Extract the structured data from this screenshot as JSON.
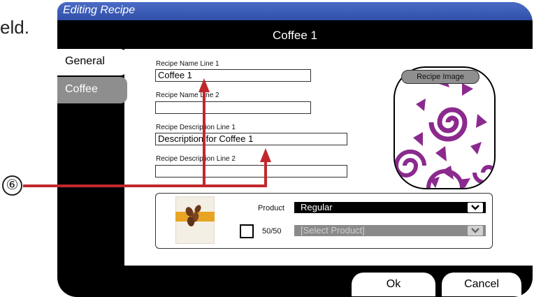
{
  "frag_text": "eld.",
  "window": {
    "title": "Editing Recipe",
    "recipe_name": "Coffee 1"
  },
  "tabs": [
    {
      "label": "General",
      "active": true
    },
    {
      "label": "Coffee",
      "active": false
    }
  ],
  "form": {
    "name_line1_label": "Recipe Name Line 1",
    "name_line1_value": "Coffee 1",
    "name_line2_label": "Recipe Name Line 2",
    "name_line2_value": "",
    "desc_line1_label": "Recipe Description Line 1",
    "desc_line1_value": "Description for Coffee 1",
    "desc_line2_label": "Recipe Description Line 2",
    "desc_line2_value": ""
  },
  "image_panel": {
    "button_label": "Recipe Image"
  },
  "product": {
    "product_label": "Product",
    "product_value": "Regular",
    "fifty_label": "50/50",
    "fifty_checked": false,
    "fifty_placeholder": "[Select Product]"
  },
  "buttons": {
    "ok": "Ok",
    "cancel": "Cancel"
  },
  "callout": {
    "number": "⑥"
  },
  "colors": {
    "titlebar": "#3a5bb8",
    "arrow": "#c0282d",
    "pattern_purple": "#8b2a8e",
    "tab_inactive": "#8e8e8e"
  }
}
